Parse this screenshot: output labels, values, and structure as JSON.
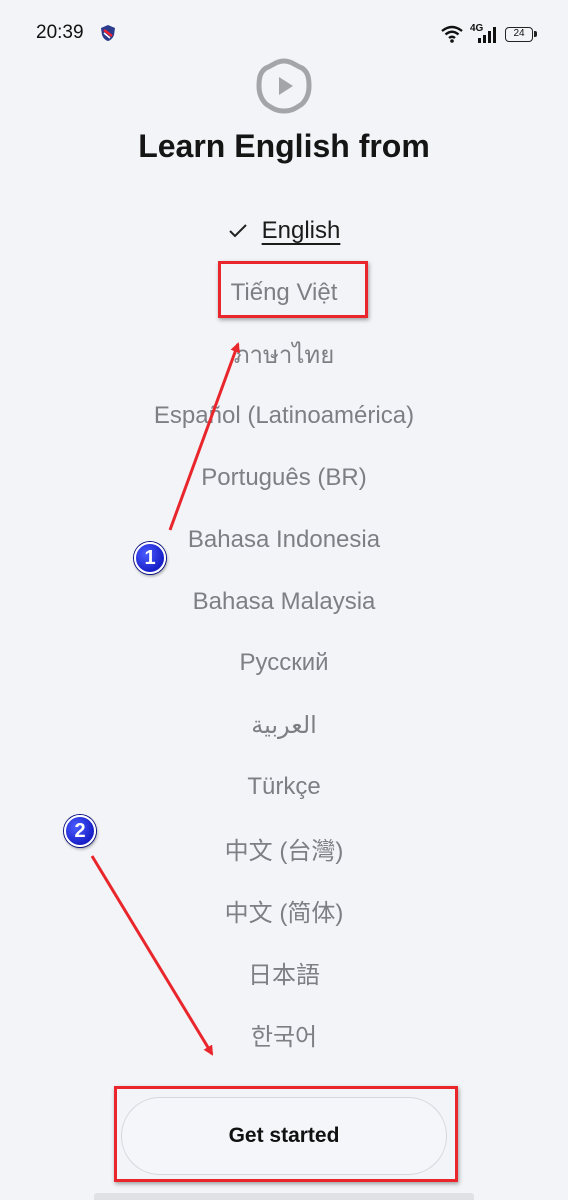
{
  "status_bar": {
    "time": "20:39",
    "network_label": "4G",
    "battery_level": "24"
  },
  "header": {
    "title": "Learn English from"
  },
  "languages": [
    {
      "label": "English",
      "selected": true
    },
    {
      "label": "Tiếng Việt",
      "selected": false
    },
    {
      "label": "ภาษาไทย",
      "selected": false
    },
    {
      "label": "Español (Latinoamérica)",
      "selected": false
    },
    {
      "label": "Português (BR)",
      "selected": false
    },
    {
      "label": "Bahasa Indonesia",
      "selected": false
    },
    {
      "label": "Bahasa Malaysia",
      "selected": false
    },
    {
      "label": "Русский",
      "selected": false
    },
    {
      "label": "العربية",
      "selected": false
    },
    {
      "label": "Türkçe",
      "selected": false
    },
    {
      "label": "中文 (台灣)",
      "selected": false
    },
    {
      "label": "中文 (简体)",
      "selected": false
    },
    {
      "label": "日本語",
      "selected": false
    },
    {
      "label": "한국어",
      "selected": false
    }
  ],
  "footer": {
    "get_started_label": "Get started"
  },
  "annotations": {
    "badge_1": "1",
    "badge_2": "2"
  },
  "colors": {
    "background": "#f2f4f7",
    "annotation_red": "#e8262b",
    "annotation_blue": "#1820c8",
    "muted_text": "#7d7f85"
  },
  "icons": {
    "check": "check-icon",
    "logo": "app-logo-icon"
  }
}
